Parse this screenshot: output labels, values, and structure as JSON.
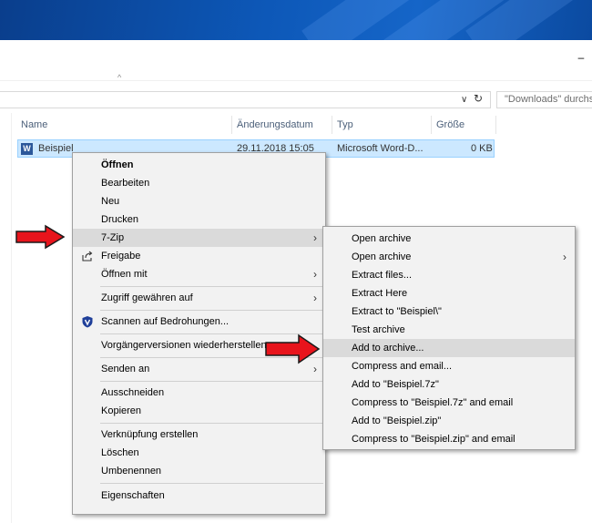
{
  "window": {
    "minimize_glyph": "–",
    "search_placeholder": "\"Downloads\" durchsuchen"
  },
  "columns": [
    {
      "label": "Name"
    },
    {
      "label": "Änderungsdatum"
    },
    {
      "label": "Typ"
    },
    {
      "label": "Größe"
    }
  ],
  "file": {
    "name": "Beispiel",
    "date": "29.11.2018 15:05",
    "type": "Microsoft Word-D...",
    "size": "0 KB",
    "icon": "word-document-icon"
  },
  "context_menu": {
    "items": [
      {
        "label": "Öffnen",
        "bold": true
      },
      {
        "label": "Bearbeiten"
      },
      {
        "label": "Neu"
      },
      {
        "label": "Drucken"
      },
      {
        "label": "7-Zip",
        "submenu": true,
        "highlighted": true
      },
      {
        "label": "Freigabe",
        "icon": "share-icon"
      },
      {
        "label": "Öffnen mit",
        "submenu": true
      },
      {
        "label": "Zugriff gewähren auf",
        "submenu": true
      },
      {
        "label": "Scannen auf Bedrohungen...",
        "icon": "shield-icon"
      },
      {
        "label": "Vorgängerversionen wiederherstellen"
      },
      {
        "label": "Senden an",
        "submenu": true
      },
      {
        "label": "Ausschneiden"
      },
      {
        "label": "Kopieren"
      },
      {
        "label": "Verknüpfung erstellen"
      },
      {
        "label": "Löschen"
      },
      {
        "label": "Umbenennen"
      },
      {
        "label": "Eigenschaften"
      }
    ]
  },
  "submenu_7zip": {
    "items": [
      {
        "label": "Open archive"
      },
      {
        "label": "Open archive",
        "submenu": true
      },
      {
        "label": "Extract files..."
      },
      {
        "label": "Extract Here"
      },
      {
        "label": "Extract to \"Beispiel\\\""
      },
      {
        "label": "Test archive"
      },
      {
        "label": "Add to archive...",
        "highlighted": true
      },
      {
        "label": "Compress and email..."
      },
      {
        "label": "Add to \"Beispiel.7z\""
      },
      {
        "label": "Compress to \"Beispiel.7z\" and email"
      },
      {
        "label": "Add to \"Beispiel.zip\""
      },
      {
        "label": "Compress to \"Beispiel.zip\" and email"
      }
    ]
  },
  "colors": {
    "selection_bg": "#cce8ff",
    "selection_border": "#99d1ff",
    "menu_bg": "#f2f2f2",
    "menu_highlight": "#dadada",
    "arrow_red": "#e8141c"
  }
}
